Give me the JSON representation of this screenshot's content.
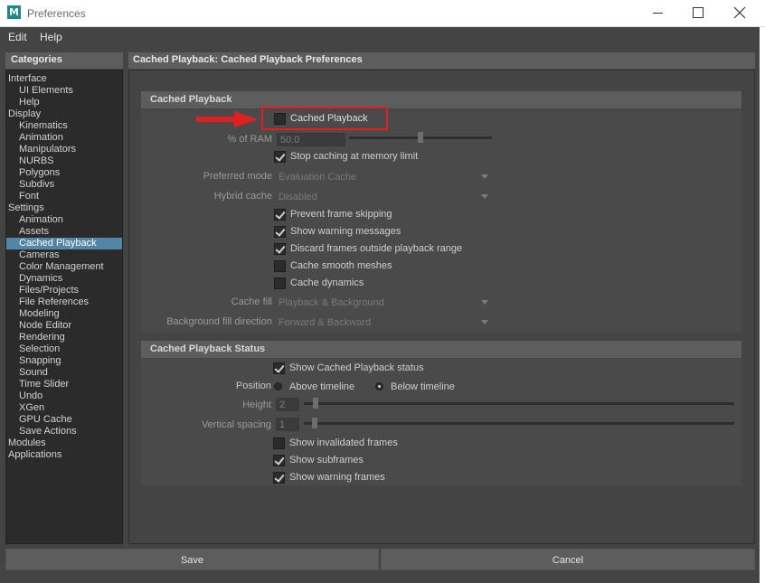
{
  "window": {
    "logo_letter": "M",
    "title": "Preferences"
  },
  "menu": [
    "Edit",
    "Help"
  ],
  "categories": {
    "header": "Categories",
    "items": [
      {
        "label": "Interface",
        "level": 0
      },
      {
        "label": "UI Elements",
        "level": 1
      },
      {
        "label": "Help",
        "level": 1
      },
      {
        "label": "Display",
        "level": 0
      },
      {
        "label": "Kinematics",
        "level": 1
      },
      {
        "label": "Animation",
        "level": 1
      },
      {
        "label": "Manipulators",
        "level": 1
      },
      {
        "label": "NURBS",
        "level": 1
      },
      {
        "label": "Polygons",
        "level": 1
      },
      {
        "label": "Subdivs",
        "level": 1
      },
      {
        "label": "Font",
        "level": 1
      },
      {
        "label": "Settings",
        "level": 0
      },
      {
        "label": "Animation",
        "level": 1
      },
      {
        "label": "Assets",
        "level": 1
      },
      {
        "label": "Cached Playback",
        "level": 1,
        "selected": true
      },
      {
        "label": "Cameras",
        "level": 1
      },
      {
        "label": "Color Management",
        "level": 1
      },
      {
        "label": "Dynamics",
        "level": 1
      },
      {
        "label": "Files/Projects",
        "level": 1
      },
      {
        "label": "File References",
        "level": 1
      },
      {
        "label": "Modeling",
        "level": 1
      },
      {
        "label": "Node Editor",
        "level": 1
      },
      {
        "label": "Rendering",
        "level": 1
      },
      {
        "label": "Selection",
        "level": 1
      },
      {
        "label": "Snapping",
        "level": 1
      },
      {
        "label": "Sound",
        "level": 1
      },
      {
        "label": "Time Slider",
        "level": 1
      },
      {
        "label": "Undo",
        "level": 1
      },
      {
        "label": "XGen",
        "level": 1
      },
      {
        "label": "GPU Cache",
        "level": 1
      },
      {
        "label": "Save Actions",
        "level": 1
      },
      {
        "label": "Modules",
        "level": 0
      },
      {
        "label": "Applications",
        "level": 0
      }
    ]
  },
  "main": {
    "header": "Cached Playback: Cached Playback Preferences",
    "section1": {
      "title": "Cached Playback",
      "cached_playback": {
        "label": "Cached Playback",
        "checked": false
      },
      "ram": {
        "label": "% of RAM",
        "value": "50.0",
        "slider": 0.5
      },
      "stop_caching": {
        "label": "Stop caching at memory limit",
        "checked": true
      },
      "preferred_mode": {
        "label": "Preferred mode",
        "value": "Evaluation Cache"
      },
      "hybrid_cache": {
        "label": "Hybrid cache",
        "value": "Disabled"
      },
      "prevent_skipping": {
        "label": "Prevent frame skipping",
        "checked": true
      },
      "show_warnings": {
        "label": "Show warning messages",
        "checked": true
      },
      "discard_frames": {
        "label": "Discard frames outside playback range",
        "checked": true
      },
      "smooth_meshes": {
        "label": "Cache smooth meshes",
        "checked": false
      },
      "cache_dynamics": {
        "label": "Cache dynamics",
        "checked": false
      },
      "cache_fill": {
        "label": "Cache fill",
        "value": "Playback & Background"
      },
      "bg_fill_direction": {
        "label": "Background fill direction",
        "value": "Forward & Backward"
      }
    },
    "section2": {
      "title": "Cached Playback Status",
      "show_status": {
        "label": "Show Cached Playback status",
        "checked": true
      },
      "position": {
        "label": "Position",
        "option1": "Above timeline",
        "option2": "Below timeline",
        "selected": "Below timeline"
      },
      "height": {
        "label": "Height",
        "value": "2"
      },
      "vertical_spacing": {
        "label": "Vertical spacing",
        "value": "1"
      },
      "show_invalidated": {
        "label": "Show invalidated frames",
        "checked": false
      },
      "show_subframes": {
        "label": "Show subframes",
        "checked": true
      },
      "show_warning_frames": {
        "label": "Show warning frames",
        "checked": true
      }
    }
  },
  "buttons": {
    "save": "Save",
    "cancel": "Cancel"
  },
  "colors": {
    "highlight": "#e02020",
    "selection": "#5285a6"
  }
}
